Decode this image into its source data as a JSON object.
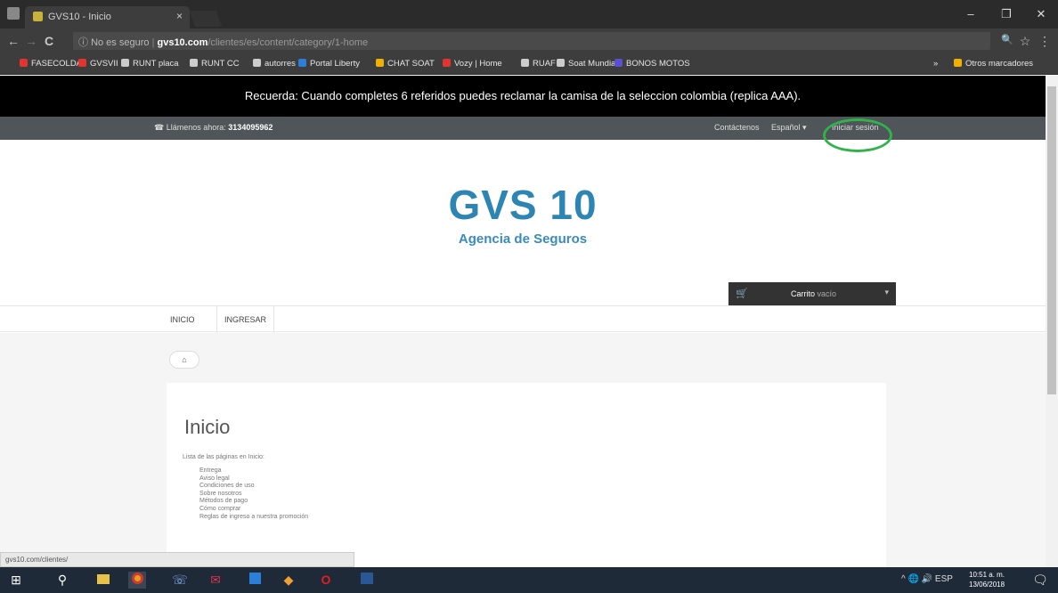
{
  "browser": {
    "tab_title": "GVS10 - Inicio",
    "tab_close": "×",
    "window_controls": {
      "minimize": "–",
      "maximize": "❐",
      "close": "✕"
    },
    "nav": {
      "back": "←",
      "forward": "→",
      "reload": "C",
      "info": "ⓘ"
    },
    "address": {
      "security": "No es seguro",
      "host": "gvs10.com",
      "path": "/clientes/es/content/category/1-home"
    },
    "zoom_icon": "🔍",
    "star_icon": "☆",
    "menu_icon": "⋮",
    "bookmarks": [
      {
        "label": "FASECOLDA",
        "color": "#e3342f"
      },
      {
        "label": "GVSVII",
        "color": "#e3342f"
      },
      {
        "label": "RUNT placa",
        "color": "#cccccc"
      },
      {
        "label": "RUNT CC",
        "color": "#cccccc"
      },
      {
        "label": "autorres",
        "color": "#cccccc"
      },
      {
        "label": "Portal Liberty",
        "color": "#2b7fd8"
      },
      {
        "label": "CHAT SOAT",
        "color": "#f0b000"
      },
      {
        "label": "Vozy | Home",
        "color": "#e3342f"
      },
      {
        "label": "RUAF",
        "color": "#cccccc"
      },
      {
        "label": "Soat Mundial",
        "color": "#cccccc"
      },
      {
        "label": "BONOS MOTOS",
        "color": "#5a4fcf"
      }
    ],
    "bookmarks_more": "»",
    "other_bookmarks": "Otros marcadores"
  },
  "page": {
    "banner": "Recuerda: Cuando completes 6 referidos puedes reclamar la camisa de la seleccion colombia (replica AAA).",
    "topnav": {
      "phone_prefix": "Llámenos ahora:",
      "phone": "3134095962",
      "contact": "Contáctenos",
      "language": "Español",
      "login": "Iniciar sesión"
    },
    "logo": "GVS 10",
    "tagline": "Agencia de Seguros",
    "cart": {
      "label": "Carrito",
      "state": "vacío"
    },
    "menu": {
      "home": "INICIO",
      "login": "INGRESAR"
    },
    "breadcrumb_home": "⌂",
    "content": {
      "title": "Inicio",
      "lead": "Lista de las páginas en Inicio:",
      "items": [
        "Entrega",
        "Aviso legal",
        "Condiciones de uso",
        "Sobre nosotros",
        "Métodos de pago",
        "Cómo comprar",
        "Reglas de ingreso a nuestra promoción"
      ]
    },
    "status_url": "gvs10.com/clientes/"
  },
  "taskbar": {
    "tray": "^  🌐  🔊  ESP",
    "time": "10:51 a. m.",
    "date": "13/06/2018"
  }
}
